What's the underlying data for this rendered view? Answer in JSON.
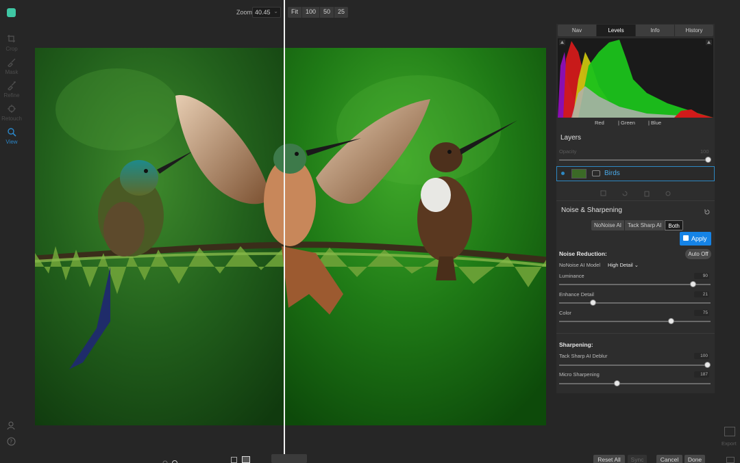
{
  "left_toolbar": {
    "tools": [
      {
        "label": "Crop",
        "icon": "crop-icon"
      },
      {
        "label": "Mask",
        "icon": "mask-brush-icon"
      },
      {
        "label": "Refine",
        "icon": "refine-brush-icon"
      },
      {
        "label": "Retouch",
        "icon": "retouch-icon"
      },
      {
        "label": "View",
        "icon": "view-pan-icon",
        "active": true
      }
    ]
  },
  "zoom": {
    "label": "Zoom",
    "value": "40.45",
    "presets": [
      "Fit",
      "100",
      "50",
      "25"
    ]
  },
  "right_panel": {
    "tabs": [
      "Nav",
      "Levels",
      "Info",
      "History"
    ],
    "active_tab": "Levels",
    "histogram_labels": [
      "Red",
      "| Green",
      "| Blue"
    ],
    "layers": {
      "title": "Layers",
      "opacity_label": "Opacity",
      "opacity_value": "100",
      "items": [
        {
          "name": "Birds",
          "selected": true
        }
      ]
    },
    "noise_sharpening": {
      "title": "Noise & Sharpening",
      "modes": [
        "NoNoise AI",
        "Tack Sharp AI",
        "Both"
      ],
      "active_mode": "Both",
      "apply_label": "Apply",
      "noise_reduction": {
        "heading": "Noise Reduction:",
        "auto_label": "Auto Off",
        "model_label": "NoNoise AI Model",
        "model_value": "High Detail",
        "sliders": [
          {
            "label": "Luminance",
            "value": 90
          },
          {
            "label": "Enhance Detail",
            "value": 21
          },
          {
            "label": "Color",
            "value": 75
          }
        ]
      },
      "sharpening": {
        "heading": "Sharpening:",
        "sliders": [
          {
            "label": "Tack Sharp AI Deblur",
            "value": 100,
            "fraction": 1.0
          },
          {
            "label": "Micro Sharpening",
            "value": 187,
            "fraction": 0.4
          }
        ]
      }
    }
  },
  "bottom_bar": {
    "reset_label": "Reset All",
    "sync_label": "Sync",
    "cancel_label": "Cancel",
    "done_label": "Done",
    "export_label": "Export"
  },
  "colors": {
    "accent": "#1583e6",
    "selection": "#2e89c4",
    "background": "#262626"
  }
}
